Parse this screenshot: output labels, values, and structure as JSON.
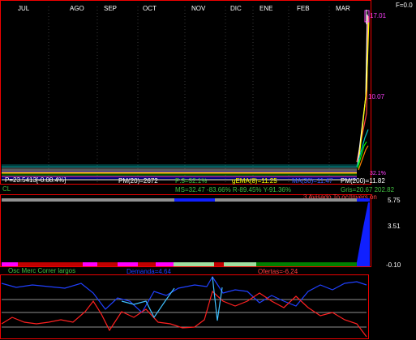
{
  "header": {
    "f_value": "F=0.0"
  },
  "months": [
    "JUL",
    "AGO",
    "SEP",
    "OCT",
    "NOV",
    "DIC",
    "ENE",
    "FEB",
    "MAR"
  ],
  "price_axis": [
    "17.01",
    "10.07"
  ],
  "ticker_pct": "32.1%",
  "indicator_line1": {
    "price": "P=23.5413[-0.08.4%]",
    "pm20": "PM(20)=2672",
    "mid": "P:3=32.1%",
    "gema": "gEMA(8)=11.25",
    "ma": "MA(30)=11.47",
    "pm200": "PM(200)=11.82"
  },
  "indicator_line2": {
    "cl": "CL",
    "ms": "MS=32.47 -83.66% R-89.45% Y-91.36%",
    "gris": "Gris=20.67 202.82"
  },
  "oscillator_title": "3 Avisado To oc/Invers ón",
  "oscillator_axis": [
    "5.75",
    "3.51",
    "-0.10"
  ],
  "bottom_labels": {
    "osc": "Osc Merc Correr largos",
    "demanda": "Demanda=4.64",
    "ofertas": "Ofertas=-6.24"
  },
  "colors": {
    "frame": "#e00000",
    "price_label": "#ff00ff",
    "gray_bar": "#909090",
    "blue": "#1020ff",
    "red": "#ff2020"
  }
}
